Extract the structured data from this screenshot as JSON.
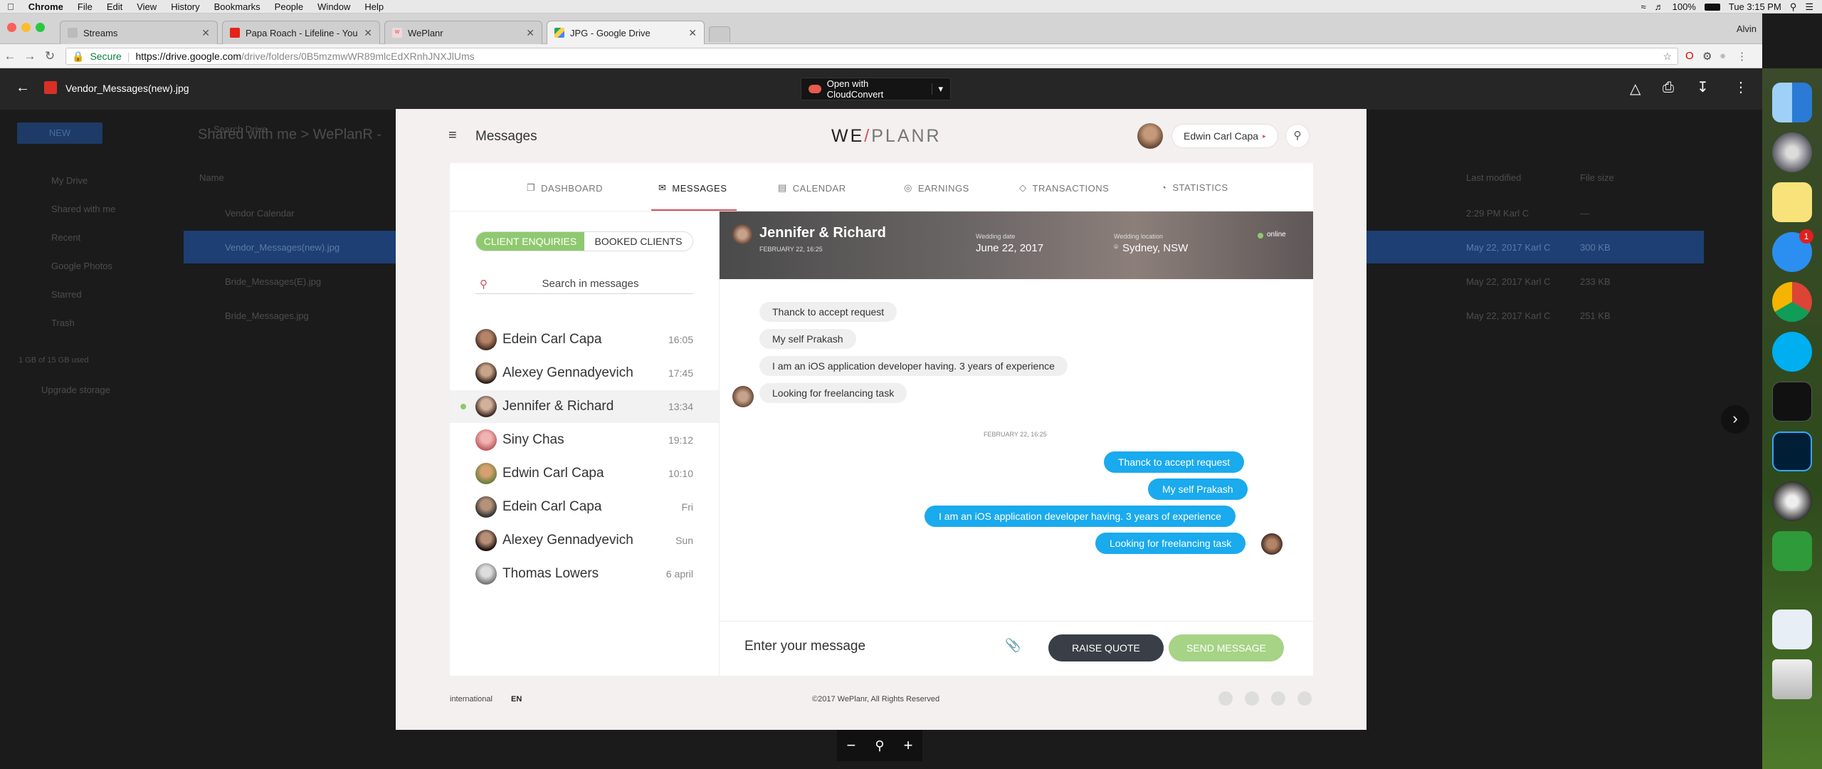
{
  "menubar": {
    "app": "Chrome",
    "items": [
      "File",
      "Edit",
      "View",
      "History",
      "Bookmarks",
      "People",
      "Window",
      "Help"
    ],
    "battery": "100%",
    "clock": "Tue 3:15 PM"
  },
  "browser": {
    "tabs": [
      {
        "title": "Streams"
      },
      {
        "title": "Papa Roach - Lifeline - YouTube"
      },
      {
        "title": "WePlanr"
      },
      {
        "title": "JPG - Google Drive"
      }
    ],
    "profile": "Alvin",
    "url_secure": "Secure",
    "url_host": "https://drive.google.com",
    "url_path": "/drive/folders/0B5mzmwWR89mlcEdXRnhJNXJlUms"
  },
  "drive": {
    "file_title": "Vendor_Messages(new).jpg",
    "open_with": "Open with CloudConvert",
    "search": "Search Drive",
    "new_btn": "NEW",
    "breadcrumb": "Shared with me  >  WePlanR -",
    "sidebar": [
      "My Drive",
      "Shared with me",
      "Recent",
      "Google Photos",
      "Starred",
      "Trash"
    ],
    "storage": "1 GB of 15 GB used",
    "upgrade": "Upgrade storage",
    "col_name": "Name",
    "col_modified": "Last modified",
    "col_size": "File size",
    "files": [
      {
        "name": "Vendor Calendar",
        "modified": "2:29 PM  Karl C",
        "size": "—"
      },
      {
        "name": "Vendor_Messages(new).jpg",
        "modified": "May 22, 2017  Karl C",
        "size": "300 KB"
      },
      {
        "name": "Bride_Messages(E).jpg",
        "modified": "May 22, 2017  Karl C",
        "size": "233 KB"
      },
      {
        "name": "Bride_Messages.jpg",
        "modified": "May 22, 2017  Karl C",
        "size": "251 KB"
      }
    ]
  },
  "app": {
    "header_title": "Messages",
    "logo_we": "WE",
    "logo_slash": "/",
    "logo_planr": "PLANR",
    "user_name": "Edwin Carl Capa",
    "nav": [
      "DASHBOARD",
      "MESSAGES",
      "CALENDAR",
      "EARNINGS",
      "TRANSACTIONS",
      "STATISTICS"
    ],
    "toggle_enquiries": "CLIENT ENQUIRIES",
    "toggle_booked": "BOOKED CLIENTS",
    "search_placeholder": "Search in messages",
    "contacts": [
      {
        "name": "Edein Carl Capa",
        "time": "16:05"
      },
      {
        "name": "Alexey Gennadyevich",
        "time": "17:45"
      },
      {
        "name": "Jennifer & Richard",
        "time": "13:34"
      },
      {
        "name": "Siny Chas",
        "time": "19:12"
      },
      {
        "name": "Edwin Carl Capa",
        "time": "10:10"
      },
      {
        "name": "Edein Carl Capa",
        "time": "Fri"
      },
      {
        "name": "Alexey Gennadyevich",
        "time": "Sun"
      },
      {
        "name": "Thomas Lowers",
        "time": "6 april"
      }
    ],
    "chat": {
      "name": "Jennifer & Richard",
      "date_small": "FEBRUARY 22, 16:25",
      "wedding_date_label": "Wedding date",
      "wedding_date": "June 22, 2017",
      "wedding_location_label": "Wedding location",
      "wedding_location": "Sydney, NSW",
      "status": "online",
      "incoming": [
        "Thanck to accept request",
        "My self Prakash",
        "I am an iOS application developer having. 3 years of experience",
        "Looking for freelancing task"
      ],
      "divider": "FEBRUARY 22, 16:25",
      "outgoing": [
        "Thanck to accept request",
        "My self Prakash",
        "I am an iOS application developer having. 3 years of experience",
        "Looking for freelancing task"
      ],
      "composer_placeholder": "Enter your message",
      "raise_quote": "RAISE QUOTE",
      "send": "SEND MESSAGE"
    },
    "footer_lang": "international",
    "footer_lang_code": "EN",
    "footer_copy": "©2017 WePlanr, All Rights Reserved"
  },
  "dock_badge": "1",
  "colors": {
    "accent": "#8fc96f",
    "brand": "#d6505c",
    "bubble": "#1aaaee",
    "selection": "#1d3f73"
  }
}
